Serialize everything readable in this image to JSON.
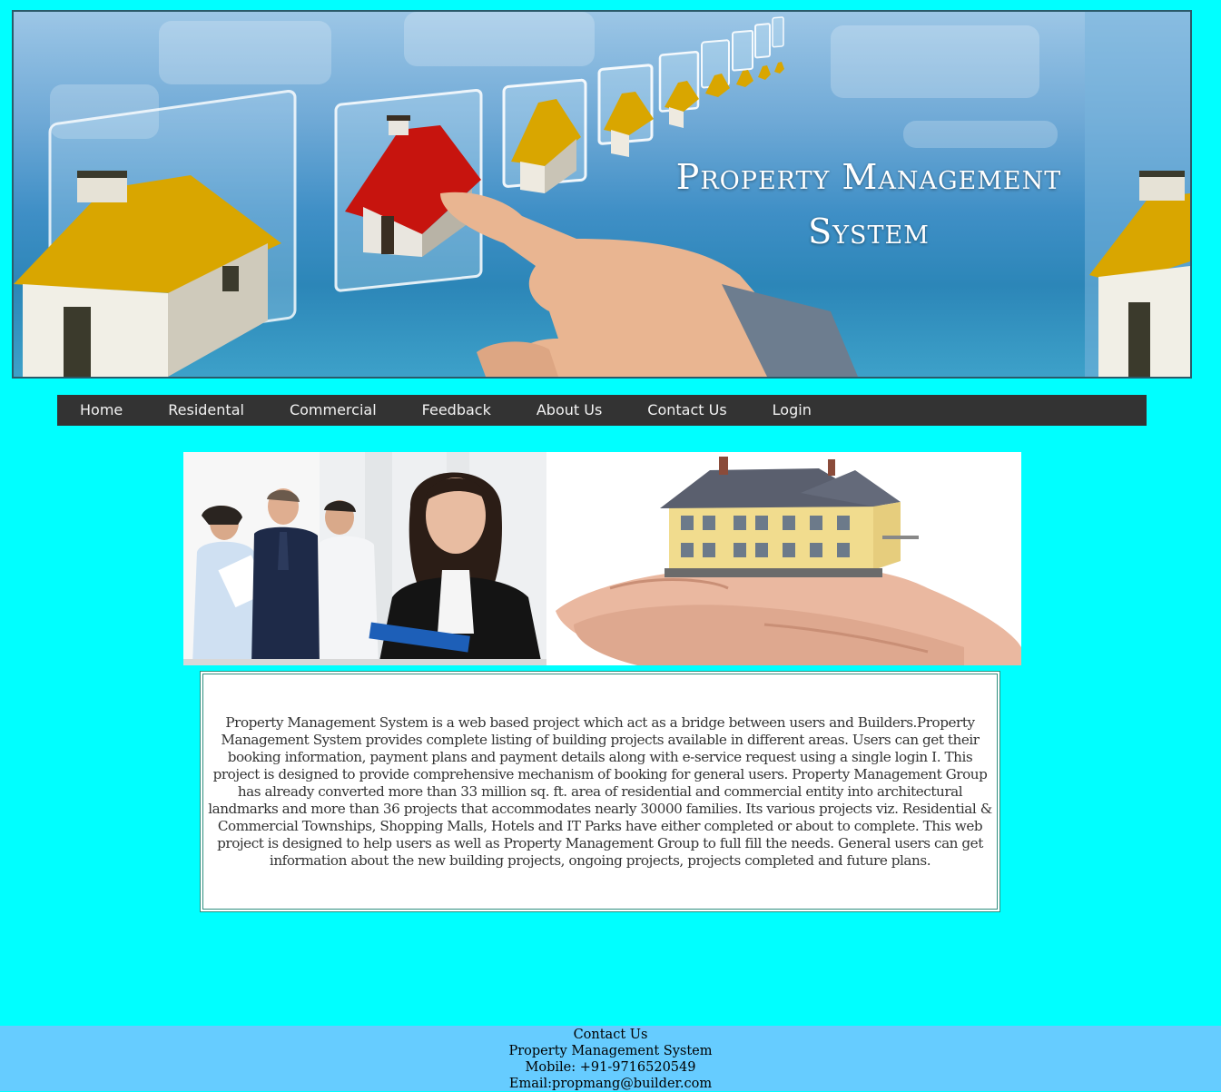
{
  "banner": {
    "title_line1": "Property Management",
    "title_line2": "System"
  },
  "nav": {
    "items": [
      "Home",
      "Residental",
      "Commercial",
      "Feedback",
      "About Us",
      "Contact Us",
      "Login"
    ]
  },
  "description": "Property Management System is a web based project which act as a bridge between users and Builders.Property Management System provides complete listing of building projects available in different areas. Users can get their booking information, payment plans and payment details along with e-service request using a single login I. This project is designed to provide comprehensive mechanism of booking for general users. Property Management Group has already converted more than 33 million sq. ft. area of residential and commercial entity into architectural landmarks and more than 36 projects that accommodates nearly 30000 families. Its various projects viz. Residential & Commercial Townships, Shopping Malls, Hotels and IT Parks have either completed or about to complete. This web project is designed to help users as well as Property Management Group to full fill the needs. General users can get information about the new building projects, ongoing projects, projects completed and future plans.",
  "footer": {
    "heading": "Contact Us",
    "company": "Property Management System",
    "mobile": "Mobile: +91-9716520549",
    "email": "Email:propmang@builder.com"
  },
  "colors": {
    "page_bg": "#00ffff",
    "nav_bg": "#333333",
    "footer_bg": "#66ccff"
  }
}
